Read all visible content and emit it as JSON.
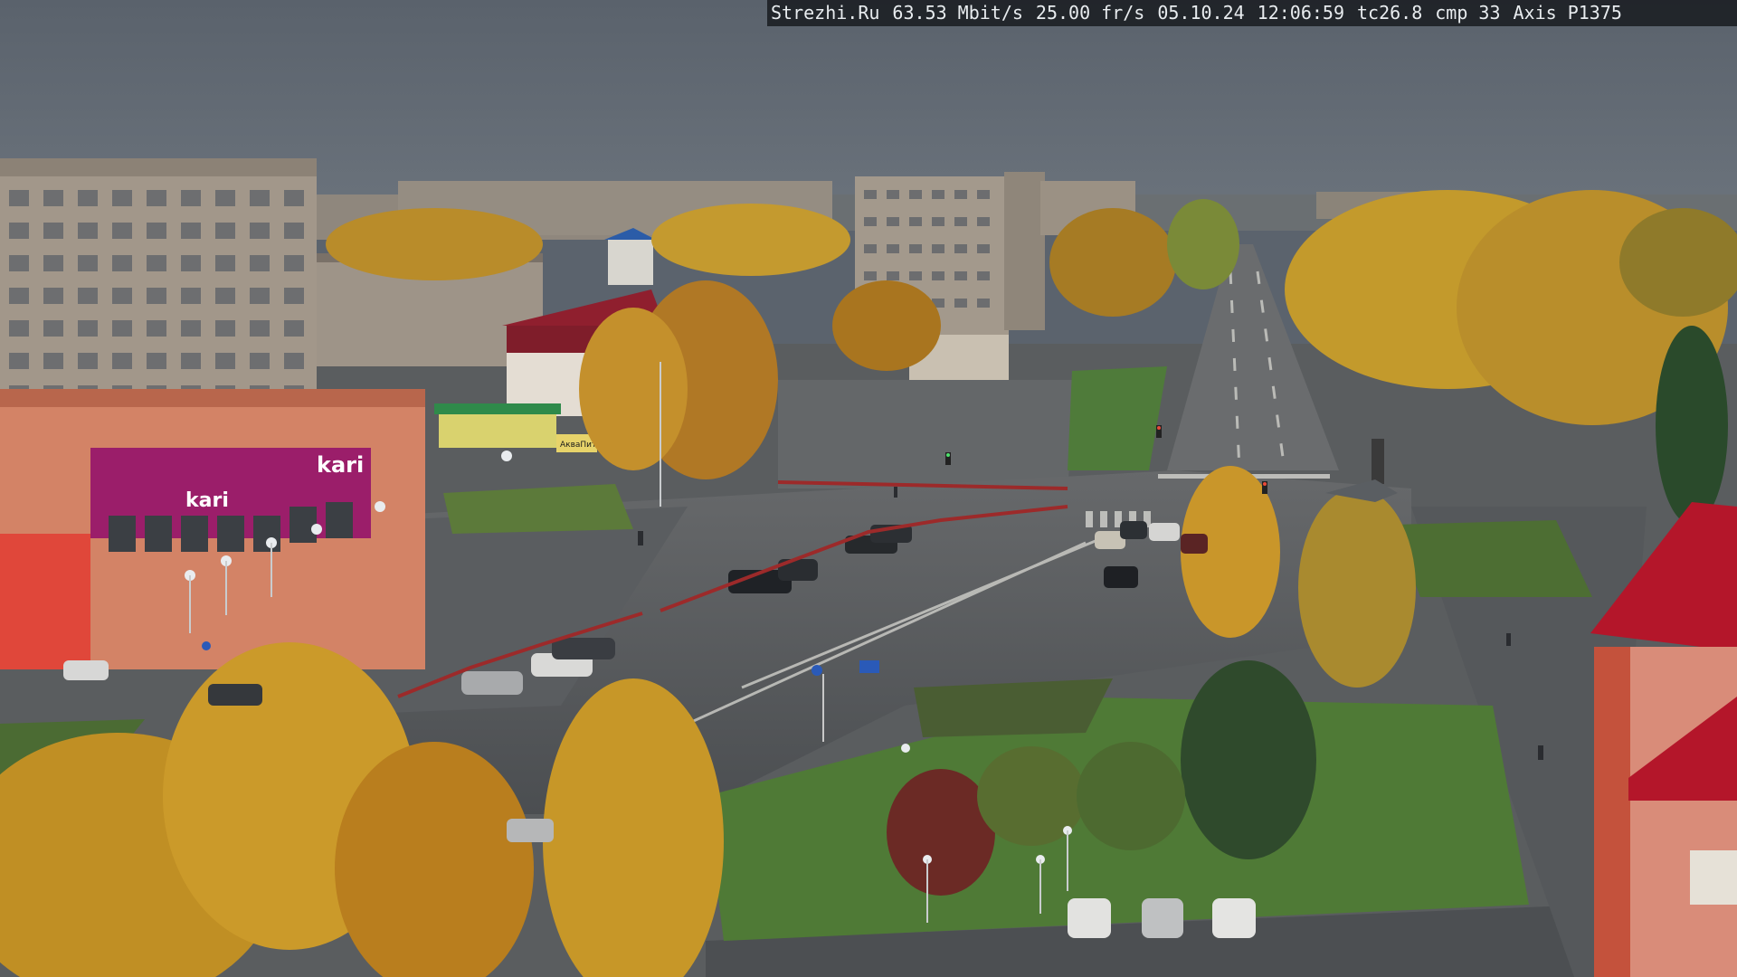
{
  "camera_overlay": {
    "site": "Strezhi.Ru",
    "bitrate": "63.53 Mbit/s",
    "framerate": "25.00 fr/s",
    "date": "05.10.24",
    "time": "12:06:59",
    "temperature": "tc26.8",
    "compression": "cmp 33",
    "camera_model": "Axis P1375"
  },
  "signage": {
    "kari_upper": "kari",
    "kari_lower": "kari",
    "akvapit": "АкваПит"
  },
  "colors": {
    "sky": "#5e6670",
    "asphalt": "#56595c",
    "foliage_yellow": "#c99a2a",
    "foliage_orange": "#b87a22",
    "grass": "#4f7a3a",
    "panel_building": "#a69a8c",
    "kari_magenta": "#9b1e6a",
    "storefront_salmon": "#d9866a",
    "red_roof": "#b4162a"
  },
  "icons": [
    "traffic-light-icon",
    "street-lamp-icon",
    "road-sign-icon"
  ]
}
